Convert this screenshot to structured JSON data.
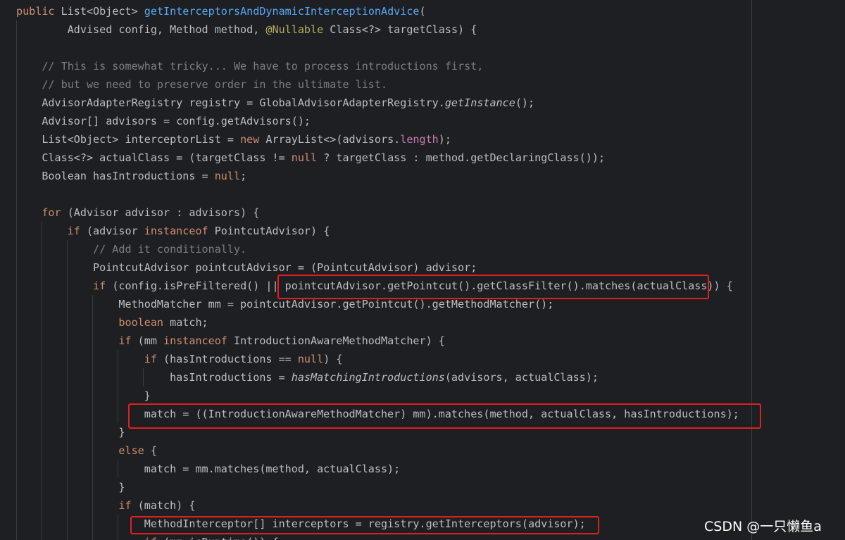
{
  "editor": {
    "theme": "dark",
    "background": "#1e1f22",
    "code_language": "java",
    "code_lines": [
      [
        [
          "kw",
          "public "
        ],
        [
          "t",
          "List<Object> "
        ],
        [
          "fn",
          "getInterceptorsAndDynamicInterceptionAdvice"
        ],
        [
          "t",
          "("
        ]
      ],
      [
        [
          "t",
          "        Advised config, Method method, "
        ],
        [
          "an",
          "@Nullable"
        ],
        [
          "t",
          " Class<?> targetClass) {"
        ]
      ],
      [],
      [
        [
          "cm",
          "    // This is somewhat tricky... We have to process introductions first,"
        ]
      ],
      [
        [
          "cm",
          "    // but we need to preserve order in the ultimate list."
        ]
      ],
      [
        [
          "t",
          "    AdvisorAdapterRegistry registry = GlobalAdvisorAdapterRegistry."
        ],
        [
          "it",
          "getInstance"
        ],
        [
          "t",
          "();"
        ]
      ],
      [
        [
          "t",
          "    Advisor[] advisors = config.getAdvisors();"
        ]
      ],
      [
        [
          "t",
          "    List<Object> interceptorList = "
        ],
        [
          "kw",
          "new"
        ],
        [
          "t",
          " ArrayList<>(advisors."
        ],
        [
          "fld",
          "length"
        ],
        [
          "t",
          ");"
        ]
      ],
      [
        [
          "t",
          "    Class<?> actualClass = (targetClass != "
        ],
        [
          "kw",
          "null"
        ],
        [
          "t",
          " ? targetClass : method.getDeclaringClass());"
        ]
      ],
      [
        [
          "t",
          "    Boolean hasIntroductions = "
        ],
        [
          "kw",
          "null"
        ],
        [
          "t",
          ";"
        ]
      ],
      [],
      [
        [
          "kw",
          "    for"
        ],
        [
          "t",
          " (Advisor advisor : advisors) {"
        ]
      ],
      [
        [
          "kw",
          "        if"
        ],
        [
          "t",
          " (advisor "
        ],
        [
          "kw",
          "instanceof"
        ],
        [
          "t",
          " PointcutAdvisor) {"
        ]
      ],
      [
        [
          "cm",
          "            // Add it conditionally."
        ]
      ],
      [
        [
          "t",
          "            PointcutAdvisor pointcutAdvisor = (PointcutAdvisor) advisor;"
        ]
      ],
      [
        [
          "kw",
          "            if"
        ],
        [
          "t",
          " (config.isPreFiltered() || pointcutAdvisor.getPointcut().getClassFilter().matches(actualClass)) {"
        ]
      ],
      [
        [
          "t",
          "                MethodMatcher mm = pointcutAdvisor.getPointcut().getMethodMatcher();"
        ]
      ],
      [
        [
          "kw",
          "                boolean"
        ],
        [
          "t",
          " match;"
        ]
      ],
      [
        [
          "kw",
          "                if"
        ],
        [
          "t",
          " (mm "
        ],
        [
          "kw",
          "instanceof"
        ],
        [
          "t",
          " IntroductionAwareMethodMatcher) {"
        ]
      ],
      [
        [
          "kw",
          "                    if"
        ],
        [
          "t",
          " (hasIntroductions == "
        ],
        [
          "kw",
          "null"
        ],
        [
          "t",
          ") {"
        ]
      ],
      [
        [
          "t",
          "                        hasIntroductions = "
        ],
        [
          "it",
          "hasMatchingIntroductions"
        ],
        [
          "t",
          "(advisors, actualClass);"
        ]
      ],
      [
        [
          "t",
          "                    }"
        ]
      ],
      [
        [
          "t",
          "                    match = ((IntroductionAwareMethodMatcher) mm).matches(method, actualClass, hasIntroductions);"
        ]
      ],
      [
        [
          "t",
          "                }"
        ]
      ],
      [
        [
          "kw",
          "                else"
        ],
        [
          "t",
          " {"
        ]
      ],
      [
        [
          "t",
          "                    match = mm.matches(method, actualClass);"
        ]
      ],
      [
        [
          "t",
          "                }"
        ]
      ],
      [
        [
          "kw",
          "                if"
        ],
        [
          "t",
          " (match) {"
        ]
      ],
      [
        [
          "t",
          "                    MethodInterceptor[] interceptors = registry.getInterceptors(advisor);"
        ]
      ],
      [
        [
          "kw",
          "                    if"
        ],
        [
          "t",
          " (mm.isRuntime()) {"
        ]
      ]
    ]
  },
  "highlight_color": "#e02020",
  "watermark": {
    "text": "CSDN @一只懒鱼a"
  }
}
